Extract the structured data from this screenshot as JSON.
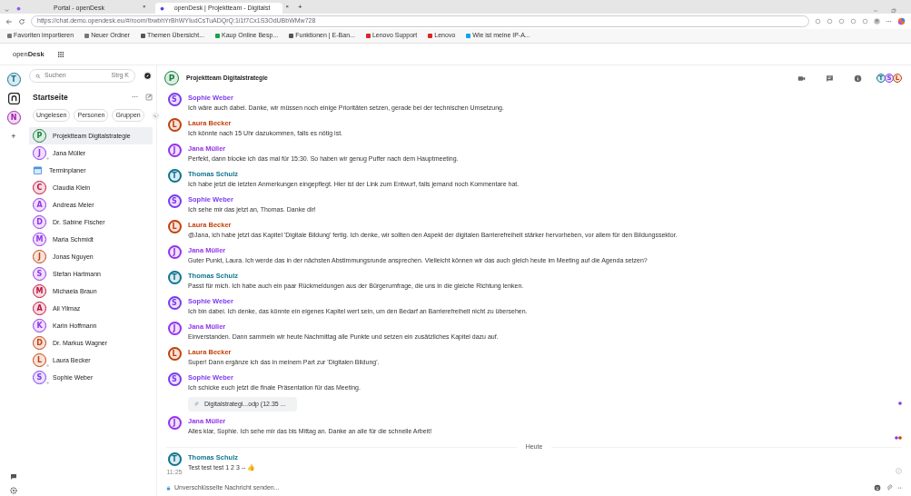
{
  "browser": {
    "tabs": [
      {
        "title": "Portal - openDesk",
        "close": "×",
        "selected": false
      },
      {
        "title": "openDesk | Projektteam - Digitalst",
        "close": "×",
        "selected": true
      }
    ],
    "new_tab": "+",
    "url": "https://chat.demo.opendesk.eu/#/room/!bwbhYrBhWYIudCsTuADQrQ:1i1f7Cx1S3OdUBbWMw728",
    "bookmarks": [
      "Favoriten importieren",
      "Neuer Ordner",
      "Themen Übersicht...",
      "Kaup Online Besp...",
      "Funktionen | E-Ban...",
      "Lenovo Support",
      "Lenovo",
      "Wie ist meine IP-A..."
    ]
  },
  "app": {
    "logo_light": "open",
    "logo_bold": "Desk"
  },
  "spaces": [
    {
      "kind": "avatar",
      "letter": "T",
      "color": "#0e7490",
      "selected": false
    },
    {
      "kind": "home",
      "selected": true
    },
    {
      "kind": "avatar",
      "letter": "N",
      "color": "#a21caf",
      "selected": false
    },
    {
      "kind": "add",
      "label": "+",
      "selected": false
    }
  ],
  "sidebar": {
    "search": {
      "placeholder": "Suchen",
      "shortcut": "Strg K"
    },
    "title": "Startseite",
    "more": "···",
    "filters": [
      "Ungelesen",
      "Personen",
      "Gruppen"
    ],
    "rooms": [
      {
        "kind": "avatar",
        "letter": "P",
        "name": "Projektteam Digitalstrategie",
        "color": "#15803d",
        "presence": false,
        "selected": true
      },
      {
        "kind": "avatar",
        "letter": "J",
        "name": "Jana Müller",
        "color": "#9333ea",
        "presence": true,
        "selected": false
      },
      {
        "kind": "calendar",
        "name": "Terminplaner",
        "selected": false
      },
      {
        "kind": "avatar",
        "letter": "C",
        "name": "Claudia Klein",
        "color": "#be123c",
        "presence": false,
        "selected": false
      },
      {
        "kind": "avatar",
        "letter": "A",
        "name": "Andreas Meier",
        "color": "#9333ea",
        "presence": false,
        "selected": false
      },
      {
        "kind": "avatar",
        "letter": "D",
        "name": "Dr. Sabine Fischer",
        "color": "#9333ea",
        "presence": false,
        "selected": false
      },
      {
        "kind": "avatar",
        "letter": "M",
        "name": "Maria Schmidt",
        "color": "#9333ea",
        "presence": false,
        "selected": false
      },
      {
        "kind": "avatar",
        "letter": "J",
        "name": "Jonas Nguyen",
        "color": "#c2410c",
        "presence": false,
        "selected": false
      },
      {
        "kind": "avatar",
        "letter": "S",
        "name": "Stefan Hartmann",
        "color": "#9333ea",
        "presence": false,
        "selected": false
      },
      {
        "kind": "avatar",
        "letter": "M",
        "name": "Michaela Braun",
        "color": "#be123c",
        "presence": false,
        "selected": false
      },
      {
        "kind": "avatar",
        "letter": "A",
        "name": "Ali Yilmaz",
        "color": "#be123c",
        "presence": false,
        "selected": false
      },
      {
        "kind": "avatar",
        "letter": "K",
        "name": "Karin Hoffmann",
        "color": "#9333ea",
        "presence": false,
        "selected": false
      },
      {
        "kind": "avatar",
        "letter": "D",
        "name": "Dr. Markus Wagner",
        "color": "#c2410c",
        "presence": false,
        "selected": false
      },
      {
        "kind": "avatar",
        "letter": "L",
        "name": "Laura Becker",
        "color": "#c2410c",
        "presence": true,
        "selected": false
      },
      {
        "kind": "avatar",
        "letter": "S",
        "name": "Sophie Weber",
        "color": "#7c3aed",
        "presence": true,
        "selected": false
      }
    ]
  },
  "room": {
    "letter": "P",
    "color": "#15803d",
    "title": "Projektteam Digitalstrategie",
    "members": [
      {
        "letter": "T",
        "color": "#0e7490"
      },
      {
        "letter": "S",
        "color": "#7c3aed"
      },
      {
        "letter": "L",
        "color": "#c2410c"
      }
    ]
  },
  "messages": [
    {
      "kind": "message",
      "letter": "S",
      "sender": "Sophie Weber",
      "color": "#7c3aed",
      "body": "Ich wäre auch dabei. Danke, wir müssen noch einige Prioritäten setzen, gerade bei der technischen Umsetzung."
    },
    {
      "kind": "message",
      "letter": "L",
      "sender": "Laura Becker",
      "color": "#c2410c",
      "body": "Ich könnte nach 15 Uhr dazukommen, falls es nötig ist."
    },
    {
      "kind": "message",
      "letter": "J",
      "sender": "Jana Müller",
      "color": "#9333ea",
      "body": "Perfekt, dann blocke ich das mal für 15:30. So haben wir genug Puffer nach dem Hauptmeeting."
    },
    {
      "kind": "message",
      "letter": "T",
      "sender": "Thomas Schulz",
      "color": "#0e7490",
      "body": "Ich habe jetzt die letzten Anmerkungen eingepflegt. Hier ist der Link zum Entwurf, falls jemand noch Kommentare hat."
    },
    {
      "kind": "message",
      "letter": "S",
      "sender": "Sophie Weber",
      "color": "#7c3aed",
      "body": "Ich sehe mir das jetzt an, Thomas. Danke dir!"
    },
    {
      "kind": "message",
      "letter": "L",
      "sender": "Laura Becker",
      "color": "#c2410c",
      "body": "@Jana, ich habe jetzt das Kapitel 'Digitale Bildung' fertig. Ich denke, wir sollten den Aspekt der digitalen Barrierefreiheit stärker hervorheben, vor allem für den Bildungssektor."
    },
    {
      "kind": "message",
      "letter": "J",
      "sender": "Jana Müller",
      "color": "#9333ea",
      "body": "Guter Punkt, Laura. Ich werde das in der nächsten Abstimmungsrunde ansprechen. Vielleicht können wir das auch gleich heute im Meeting auf die Agenda setzen?"
    },
    {
      "kind": "message",
      "letter": "T",
      "sender": "Thomas Schulz",
      "color": "#0e7490",
      "body": "Passt für mich. Ich habe auch ein paar Rückmeldungen aus der Bürgerumfrage, die uns in die gleiche Richtung lenken."
    },
    {
      "kind": "message",
      "letter": "S",
      "sender": "Sophie Weber",
      "color": "#7c3aed",
      "body": "Ich bin dabei. Ich denke, das könnte ein eigenes Kapitel wert sein, um den Bedarf an Barrierefreiheit nicht zu übersehen."
    },
    {
      "kind": "message",
      "letter": "J",
      "sender": "Jana Müller",
      "color": "#9333ea",
      "body": "Einverstanden. Dann sammeln wir heute Nachmittag alle Punkte und setzen ein zusätzliches Kapitel dazu auf."
    },
    {
      "kind": "message",
      "letter": "L",
      "sender": "Laura Becker",
      "color": "#c2410c",
      "body": "Super! Dann ergänze ich das in meinem Part zur 'Digitalen Bildung'."
    },
    {
      "kind": "message",
      "letter": "S",
      "sender": "Sophie Weber",
      "color": "#7c3aed",
      "body": "Ich schicke euch jetzt die finale Präsentation für das Meeting.",
      "attachment": "Digitalstrategi...odp (12.35 ...",
      "receipts": [
        {
          "color": "#7c3aed"
        }
      ]
    },
    {
      "kind": "message",
      "letter": "J",
      "sender": "Jana Müller",
      "color": "#9333ea",
      "body": "Alles klar, Sophie. Ich sehe mir das bis Mittag an. Danke an alle für die schnelle Arbeit!",
      "receipts": [
        {
          "color": "#9333ea"
        },
        {
          "color": "#c2410c"
        }
      ]
    },
    {
      "kind": "divider",
      "label": "Heute"
    },
    {
      "kind": "message",
      "letter": "T",
      "sender": "Thomas Schulz",
      "color": "#0e7490",
      "time": "11:25",
      "body": "Test test test 1 2 3 -- 👍",
      "sent": true
    }
  ],
  "composer": {
    "placeholder": "Unverschlüsselte Nachricht senden..."
  }
}
